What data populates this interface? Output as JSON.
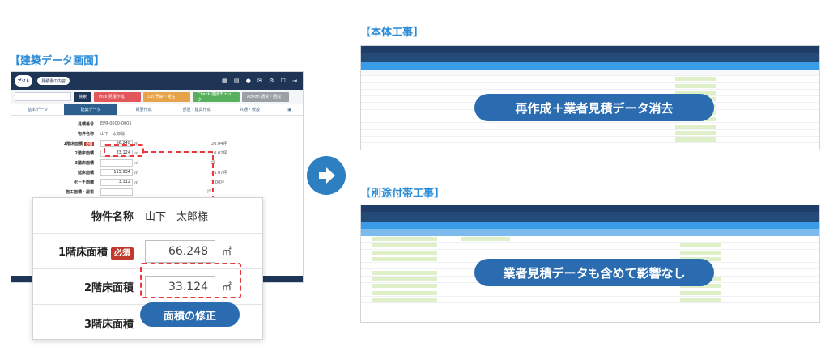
{
  "left": {
    "section_label": "【建築データ画面】",
    "app_tag": "ア゙ジト",
    "pill_text": "見積書の内容",
    "buttons": {
      "search": "検索",
      "b1": "Plus 見積作成",
      "b2": "Do 予算・発注",
      "b3": "Check 進捗チェック",
      "b4": "Action 請求・回収"
    },
    "tabs": [
      "基本データ",
      "建築データ",
      "概要作成",
      "部屋・建具作成",
      "共通・仮設",
      ""
    ],
    "rows": [
      {
        "label": "見積番号",
        "value": "EPR-0000-0005"
      },
      {
        "label": "物件名称",
        "value": "山下　太郎様"
      },
      {
        "label": "1階床面積",
        "value": "66.248",
        "unit": "㎡",
        "aux": "20.04坪",
        "required": "必須"
      },
      {
        "label": "2階床面積",
        "value": "33.124",
        "unit": "㎡",
        "aux": "10.02坪"
      },
      {
        "label": "3階床面積",
        "value": "",
        "unit": "㎡",
        "aux": "坪"
      },
      {
        "label": "延床面積",
        "value": "115.934",
        "unit": "㎡",
        "aux": "35.07坪"
      },
      {
        "label": "ポーチ面積",
        "value": "3.312",
        "unit": "㎡",
        "aux": "1.00坪"
      },
      {
        "label": "施工面積・屋根",
        "value": "",
        "unit": "",
        "aux": "坪"
      }
    ],
    "zoom": {
      "name_label": "物件名称",
      "name_value": "山下　太郎様",
      "f1_label": "1階床面積",
      "required": "必須",
      "f1_value": "66.248",
      "f2_label": "2階床面積",
      "f2_value": "33.124",
      "unit": "㎡",
      "f3_label": "3階床面積"
    },
    "callout": "面積の修正"
  },
  "right_top": {
    "section_label": "【本体工事】",
    "overlay": "再作成＋業者見積データ消去"
  },
  "right_bottom": {
    "section_label": "【別途付帯工事】",
    "overlay": "業者見積データも含めて影響なし"
  },
  "colors": {
    "accent": "#2b6cb0",
    "label_blue": "#2a8bd6",
    "dash_red": "#e8393d",
    "required_red": "#c0392b"
  }
}
